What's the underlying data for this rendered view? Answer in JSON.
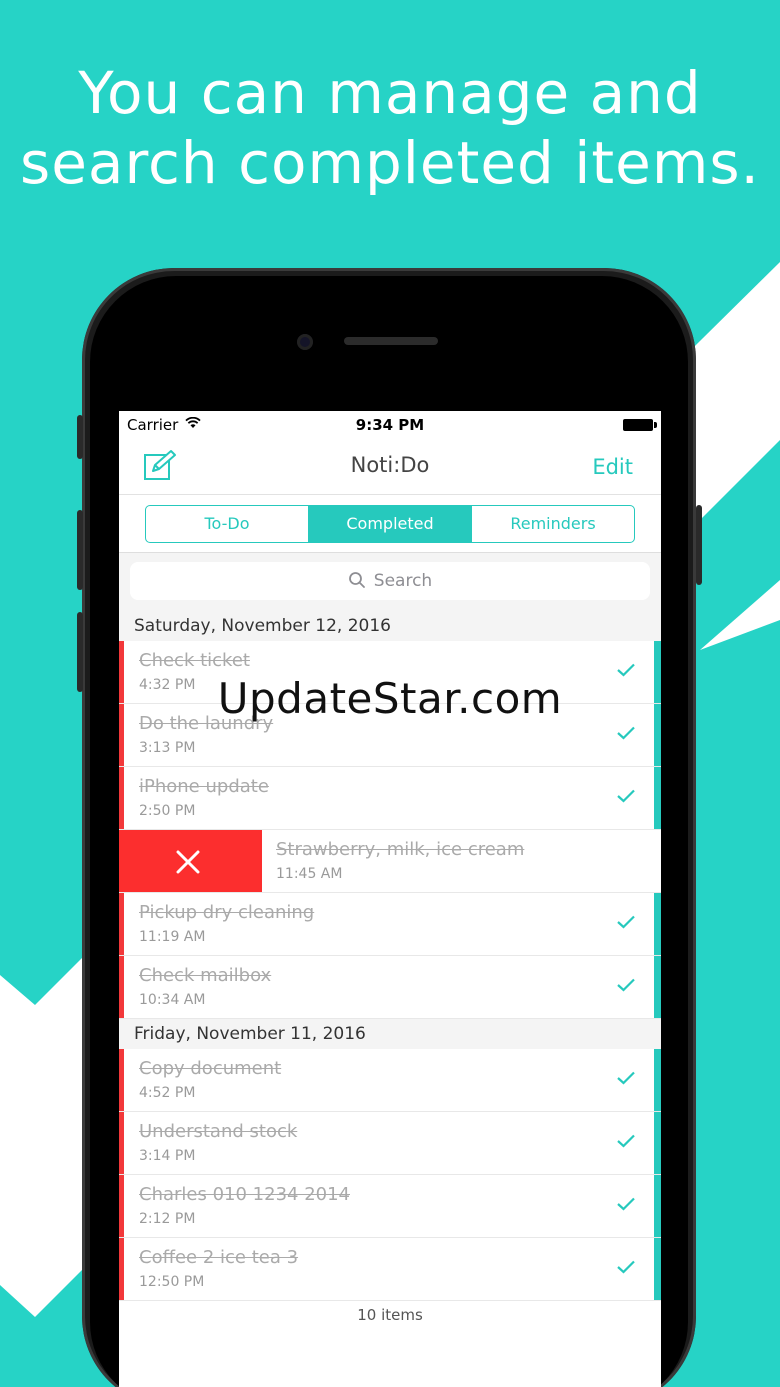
{
  "headline": {
    "line1": "You can manage and",
    "line2": "search completed items."
  },
  "status_bar": {
    "carrier": "Carrier",
    "time": "9:34 PM"
  },
  "navbar": {
    "title": "Noti:Do",
    "edit_label": "Edit"
  },
  "tabs": [
    {
      "label": "To-Do",
      "active": false
    },
    {
      "label": "Completed",
      "active": true
    },
    {
      "label": "Reminders",
      "active": false
    }
  ],
  "search": {
    "placeholder": "Search"
  },
  "sections": [
    {
      "header": "Saturday, November 12, 2016",
      "items": [
        {
          "title": "Check ticket",
          "time": "4:32 PM"
        },
        {
          "title": "Do the laundry",
          "time": "3:13 PM"
        },
        {
          "title": "iPhone update",
          "time": "2:50 PM"
        },
        {
          "title": "Strawberry, milk, ice cream",
          "time": "11:45 AM",
          "swiped": true
        },
        {
          "title": "Pickup dry cleaning",
          "time": "11:19 AM"
        },
        {
          "title": "Check mailbox",
          "time": "10:34 AM"
        }
      ]
    },
    {
      "header": "Friday, November 11, 2016",
      "items": [
        {
          "title": "Copy document",
          "time": "4:52 PM"
        },
        {
          "title": "Understand stock",
          "time": "3:14 PM"
        },
        {
          "title": "Charles 010 1234 2014",
          "time": "2:12 PM"
        },
        {
          "title": "Coffee 2 ice tea 3",
          "time": "12:50 PM"
        }
      ]
    }
  ],
  "footer": {
    "count": "10 items"
  },
  "watermark": "UpdateStar.com",
  "colors": {
    "accent": "#26c9bd",
    "background": "#26d3c6",
    "delete": "#fc2e2e",
    "done_bar": "#f2383a"
  },
  "icons": {
    "compose": "compose-icon",
    "search": "search-icon",
    "check": "check-icon",
    "delete": "x-icon",
    "wifi": "wifi-icon",
    "battery": "battery-icon"
  }
}
